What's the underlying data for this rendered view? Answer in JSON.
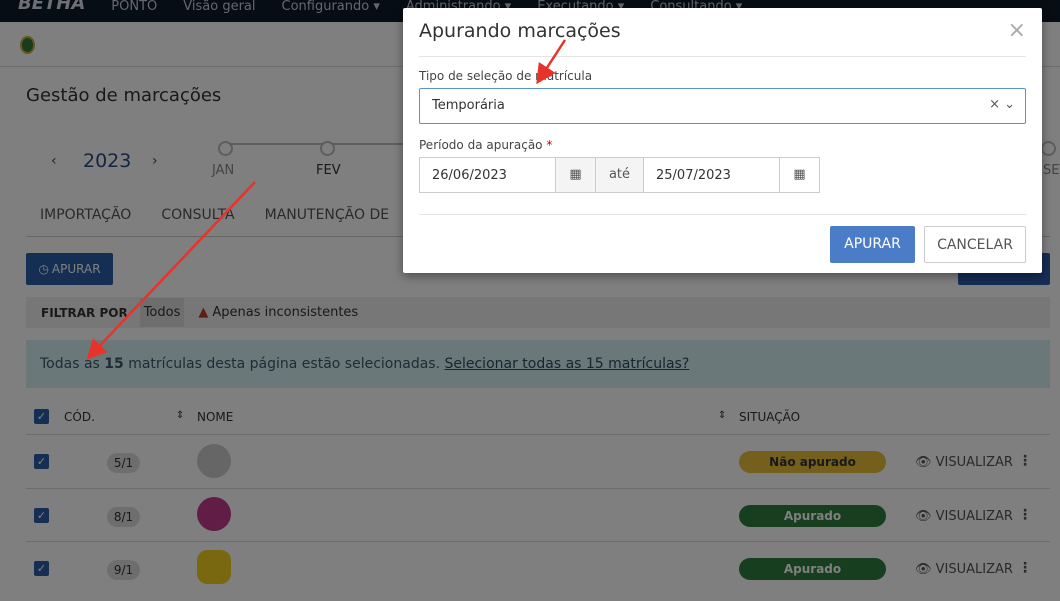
{
  "nav": {
    "brand": "BETHA",
    "product": "PONTO",
    "items": [
      "Visão geral",
      "Configurando ▾",
      "Administrando ▾",
      "Executando ▾",
      "Consultando ▾"
    ]
  },
  "page": {
    "title": "Gestão de marcações",
    "year": "2023",
    "prev": "‹",
    "next": "›",
    "months": [
      "JAN",
      "FEV",
      "SET"
    ],
    "tabs": [
      "IMPORTAÇÃO",
      "CONSULTA",
      "MANUTENÇÃO DE"
    ],
    "apurar_label": "APURAR",
    "filter": {
      "label": "FILTRAR POR",
      "all": "Todos",
      "inconsistent": "Apenas inconsistentes"
    },
    "info": {
      "pre": "Todas as ",
      "count": "15",
      "post": " matrículas desta página estão selecionadas. ",
      "link": "Selecionar todas as 15 matrículas?"
    },
    "columns": {
      "cod": "CÓD.",
      "nome": "NOME",
      "situacao": "SITUAÇÃO"
    },
    "rows": [
      {
        "cod": "5/1",
        "status": "Não apurado",
        "action": "VISUALIZAR"
      },
      {
        "cod": "8/1",
        "status": "Apurado",
        "action": "VISUALIZAR"
      },
      {
        "cod": "9/1",
        "status": "Apurado",
        "action": "VISUALIZAR"
      }
    ]
  },
  "modal": {
    "title": "Apurando marcações",
    "close": "×",
    "type_label": "Tipo de seleção de matrícula",
    "type_value": "Temporária",
    "period_label": "Período da apuração",
    "required": "*",
    "start": "26/06/2023",
    "until": "até",
    "end": "25/07/2023",
    "confirm": "APURAR",
    "cancel": "CANCELAR"
  },
  "colors": {
    "primary": "#2a5ca8",
    "modal_primary": "#4a7cc8",
    "pending": "#e8bf3a",
    "done": "#2e7d3e",
    "annotation": "#e8332a"
  }
}
